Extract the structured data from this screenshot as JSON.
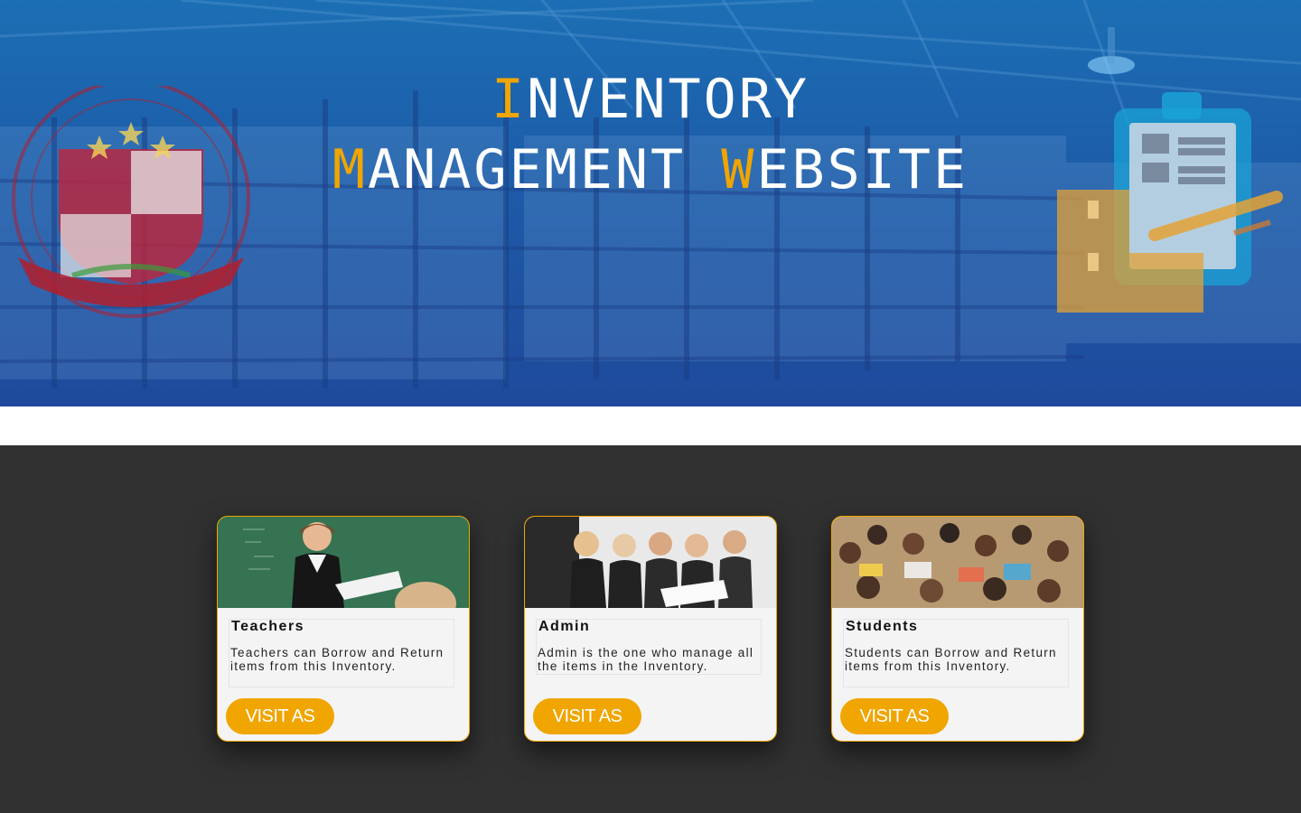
{
  "hero": {
    "title_line1": {
      "cap": "I",
      "rest": "NVENTORY"
    },
    "title_line2": {
      "cap1": "M",
      "rest1": "ANAGEMENT ",
      "cap2": "W",
      "rest2": "EBSITE"
    },
    "colors": {
      "accent": "#f0a500",
      "text": "#ffffff",
      "overlay": "#1f4a9c"
    },
    "logo_icon": "university-seal-icon",
    "clipboard_icon": "inventory-clipboard-icon"
  },
  "cards": [
    {
      "title": "Teachers",
      "description": "Teachers can Borrow and Return items from this Inventory.",
      "button_label": "VISIT AS",
      "image_icon": "teacher-photo"
    },
    {
      "title": "Admin",
      "description": "Admin is the one who manage all the items in the Inventory.",
      "button_label": "VISIT AS",
      "image_icon": "admin-photo"
    },
    {
      "title": "Students",
      "description": "Students can Borrow and Return items from this Inventory.",
      "button_label": "VISIT AS",
      "image_icon": "students-photo"
    }
  ],
  "colors": {
    "band": "#313131",
    "card_border": "#f0a500",
    "button": "#f0a500"
  }
}
